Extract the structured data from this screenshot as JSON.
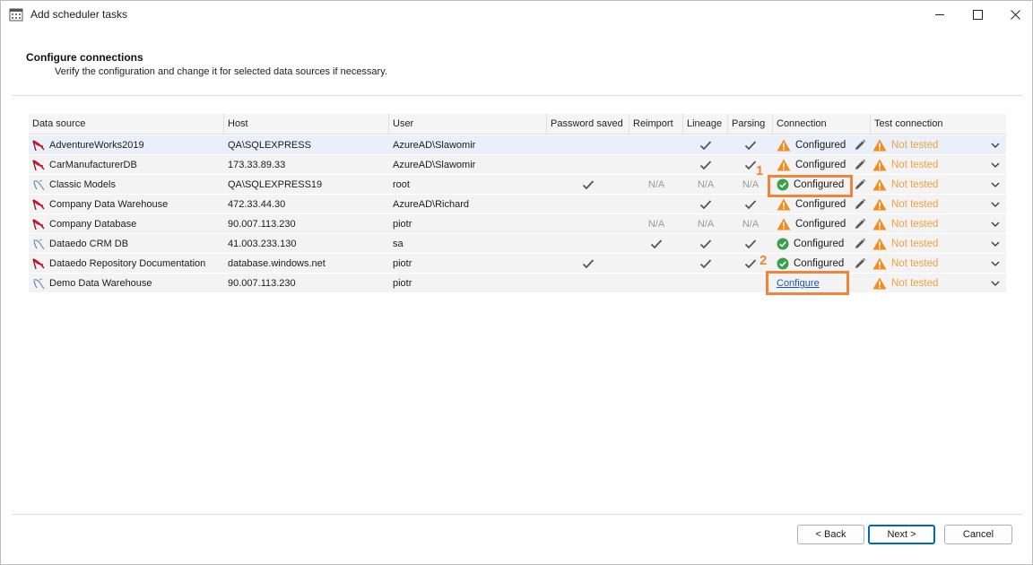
{
  "window": {
    "title": "Add scheduler tasks"
  },
  "header": {
    "title": "Configure connections",
    "subtitle": "Verify the configuration and change it for selected data sources if necessary."
  },
  "columns": [
    "Data source",
    "Host",
    "User",
    "Password saved",
    "Reimport",
    "Lineage",
    "Parsing",
    "Connection",
    "Test connection"
  ],
  "rows": [
    {
      "data_source": "AdventureWorks2019",
      "icon": "sql-server-icon",
      "host": "QA\\SQLEXPRESS",
      "user": "AzureAD\\Slawomir",
      "password_saved": "",
      "reimport": "",
      "lineage": "check",
      "parsing": "check",
      "connection": "Configured",
      "connection_state": "warning",
      "test": "Not tested"
    },
    {
      "data_source": "CarManufacturerDB",
      "icon": "sql-server-icon",
      "host": "173.33.89.33",
      "user": "AzureAD\\Slawomir",
      "password_saved": "",
      "reimport": "",
      "lineage": "check",
      "parsing": "check",
      "connection": "Configured",
      "connection_state": "warning",
      "test": "Not tested"
    },
    {
      "data_source": "Classic Models",
      "icon": "mysql-icon",
      "host": "QA\\SQLEXPRESS19",
      "user": "root",
      "password_saved": "check",
      "reimport": "N/A",
      "lineage": "N/A",
      "parsing": "N/A",
      "connection": "Configured",
      "connection_state": "ok",
      "test": "Not tested"
    },
    {
      "data_source": "Company Data Warehouse",
      "icon": "sql-server-icon",
      "host": "472.33.44.30",
      "user": "AzureAD\\Richard",
      "password_saved": "",
      "reimport": "",
      "lineage": "check",
      "parsing": "check",
      "connection": "Configured",
      "connection_state": "warning",
      "test": "Not tested"
    },
    {
      "data_source": "Company Database",
      "icon": "sql-server-icon",
      "host": "90.007.113.230",
      "user": "piotr",
      "password_saved": "",
      "reimport": "N/A",
      "lineage": "N/A",
      "parsing": "N/A",
      "connection": "Configured",
      "connection_state": "warning",
      "test": "Not tested"
    },
    {
      "data_source": "Dataedo CRM DB",
      "icon": "mysql-icon",
      "host": "41.003.233.130",
      "user": "sa",
      "password_saved": "",
      "reimport": "check",
      "lineage": "check",
      "parsing": "check",
      "connection": "Configured",
      "connection_state": "ok",
      "test": "Not tested"
    },
    {
      "data_source": "Dataedo Repository Documentation",
      "icon": "sql-server-icon",
      "host": "database.windows.net",
      "user": "piotr",
      "password_saved": "check",
      "reimport": "",
      "lineage": "check",
      "parsing": "check",
      "connection": "Configured",
      "connection_state": "ok",
      "test": "Not tested"
    },
    {
      "data_source": "Demo Data Warehouse",
      "icon": "mysql-icon",
      "host": "90.007.113.230",
      "user": "piotr",
      "password_saved": "",
      "reimport": "",
      "lineage": "",
      "parsing": "",
      "connection": "Configure",
      "connection_state": "link",
      "test": "Not tested"
    }
  ],
  "annotations": [
    "1",
    "2"
  ],
  "buttons": {
    "back": "< Back",
    "next": "Next >",
    "cancel": "Cancel"
  },
  "colors": {
    "accent_orange": "#f0843a",
    "warning": "#f28c1f",
    "ok": "#3aa04a",
    "link": "#1a57b3",
    "primary_border": "#0067c0"
  }
}
